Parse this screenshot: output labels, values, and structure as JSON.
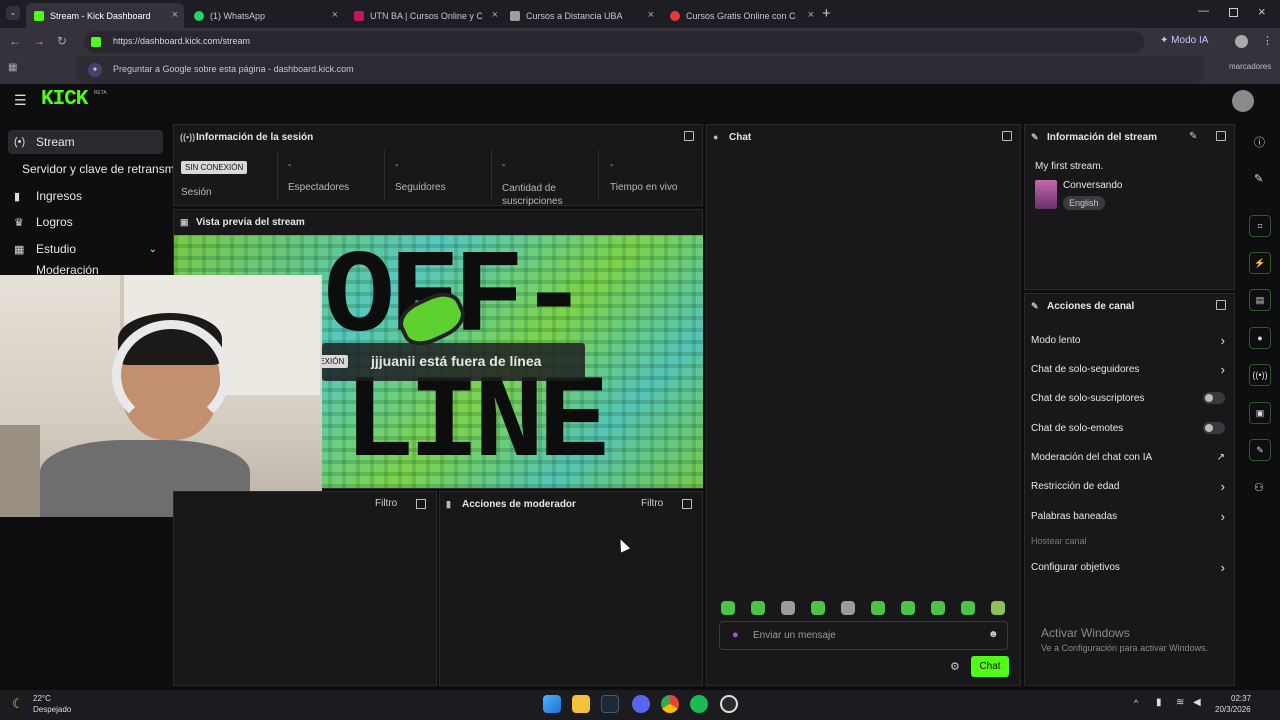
{
  "browser": {
    "tabs": [
      {
        "title": "Stream - Kick Dashboard",
        "color": "#53fc18"
      },
      {
        "title": "(1) WhatsApp",
        "color": "#25d366"
      },
      {
        "title": "UTN BA | Cursos Online y Carre",
        "color": "#c2185b"
      },
      {
        "title": "Cursos a Distancia UBA",
        "color": "#9e9e9e"
      },
      {
        "title": "Cursos Gratis Online con Certifi",
        "color": "#e53935"
      }
    ],
    "url": "https://dashboard.kick.com/stream",
    "ai_mode": "Modo IA",
    "suggestion": "Preguntar a Google sobre esta página - dashboard.kick.com",
    "bookmarks": "marcadores"
  },
  "kick": {
    "logo": "KICK",
    "beta": "BETA",
    "sidebar": [
      {
        "label": "Stream",
        "icon": "broadcast-icon"
      },
      {
        "label": "Servidor y clave de retransmi"
      },
      {
        "label": "Ingresos",
        "icon": "chart-icon"
      },
      {
        "label": "Logros",
        "icon": "trophy-icon"
      },
      {
        "label": "Estudio",
        "icon": "grid-icon"
      },
      {
        "label": "Moderación"
      }
    ],
    "session": {
      "title": "Información de la sesión",
      "status_badge": "SIN CONEXIÓN",
      "session_label": "Sesión",
      "stats": [
        {
          "value": "-",
          "label": "Espectadores"
        },
        {
          "value": "-",
          "label": "Seguidores"
        },
        {
          "value": "-",
          "label": "Cantidad de suscripciones"
        },
        {
          "value": "-",
          "label": "Tiempo en vivo"
        }
      ]
    },
    "preview": {
      "title": "Vista previa del stream",
      "badge": "SIN CONEXIÓN",
      "offline_text": "jjjuanii está fuera de línea",
      "banner_top": "OFF-",
      "banner_bottom": "LINE"
    },
    "bottom_left": {
      "filter": "Filtro"
    },
    "mod_actions": {
      "title": "Acciones de moderador",
      "filter": "Filtro"
    },
    "chat": {
      "title": "Chat",
      "placeholder": "Enviar un mensaje",
      "send": "Chat"
    },
    "stream_info": {
      "title": "Información del stream",
      "stream_title": "My first stream.",
      "category": "Conversando",
      "language": "English"
    },
    "channel_actions": {
      "title": "Acciones de canal",
      "items": [
        {
          "label": "Modo lento",
          "control": "chevron"
        },
        {
          "label": "Chat de solo-seguidores",
          "control": "chevron"
        },
        {
          "label": "Chat de solo-suscriptores",
          "control": "toggle"
        },
        {
          "label": "Chat de solo-emotes",
          "control": "toggle"
        },
        {
          "label": "Moderación del chat con IA",
          "control": "external"
        },
        {
          "label": "Restricción de edad",
          "control": "chevron"
        },
        {
          "label": "Palabras baneadas",
          "control": "chevron"
        },
        {
          "label": "Hostear canal",
          "control": "none"
        },
        {
          "label": "Configurar objetivos",
          "control": "chevron"
        }
      ]
    },
    "watermark": {
      "title": "Activar Windows",
      "subtitle": "Ve a Configuración para activar Windows."
    }
  },
  "taskbar": {
    "weather_temp": "22°C",
    "weather_desc": "Despejado",
    "time": "02:37",
    "date": "20/3/2026"
  },
  "colors": {
    "accent": "#53fc18",
    "panel": "#18181b",
    "background": "#0e0e10"
  }
}
